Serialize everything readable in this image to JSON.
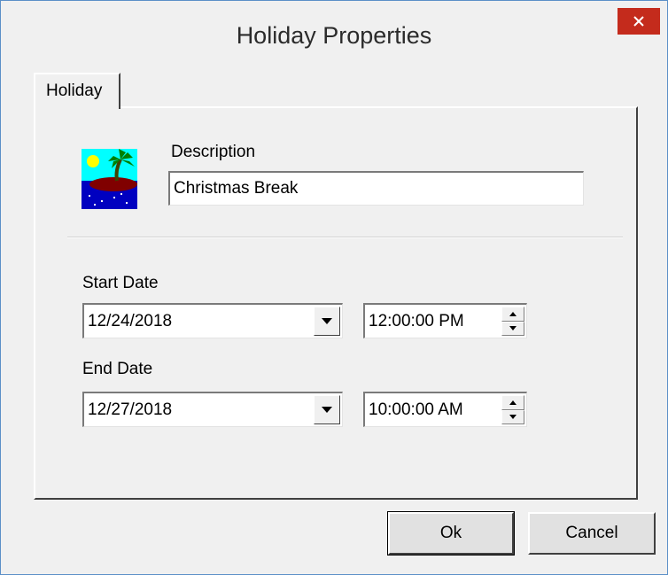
{
  "window": {
    "title": "Holiday Properties",
    "close_label": "close"
  },
  "tabs": [
    {
      "label": "Holiday",
      "selected": true
    }
  ],
  "description": {
    "label": "Description",
    "value": "Christmas Break"
  },
  "start": {
    "label": "Start Date",
    "date": "12/24/2018",
    "time": "12:00:00 PM"
  },
  "end": {
    "label": "End Date",
    "date": "12/27/2018",
    "time": "10:00:00 AM"
  },
  "buttons": {
    "ok": "Ok",
    "cancel": "Cancel"
  },
  "icons": {
    "holiday": "palm-tree-island-icon",
    "close": "close-icon",
    "dropdown": "chevron-down-icon",
    "spin_up": "arrow-up-icon",
    "spin_down": "arrow-down-icon"
  },
  "colors": {
    "close_button": "#c42b1c",
    "window_border": "#5b8fc7",
    "dialog_bg": "#f0f0f0"
  }
}
